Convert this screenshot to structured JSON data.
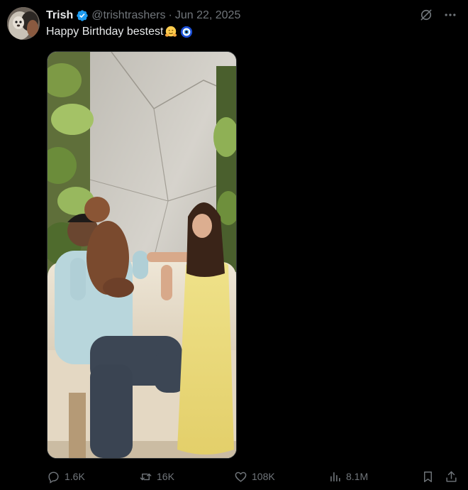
{
  "author": {
    "display_name": "Trish",
    "handle": "@trishtrashers",
    "separator": "·",
    "date": "Jun 22, 2025",
    "verified_color": "#1d9bf0"
  },
  "tweet": {
    "text": "Happy Birthday bestest",
    "emojis": [
      "hugging-face",
      "nazar-amulet"
    ]
  },
  "header_actions": {
    "grok_icon": "grok-icon",
    "more_icon": "more-dots-icon",
    "more_label": "···"
  },
  "stats": {
    "replies": "1.6K",
    "reposts": "16K",
    "likes": "108K",
    "views": "8.1M"
  },
  "colors": {
    "background": "#000000",
    "text_primary": "#e7e9ea",
    "text_secondary": "#71767b",
    "border": "#2f3336"
  }
}
